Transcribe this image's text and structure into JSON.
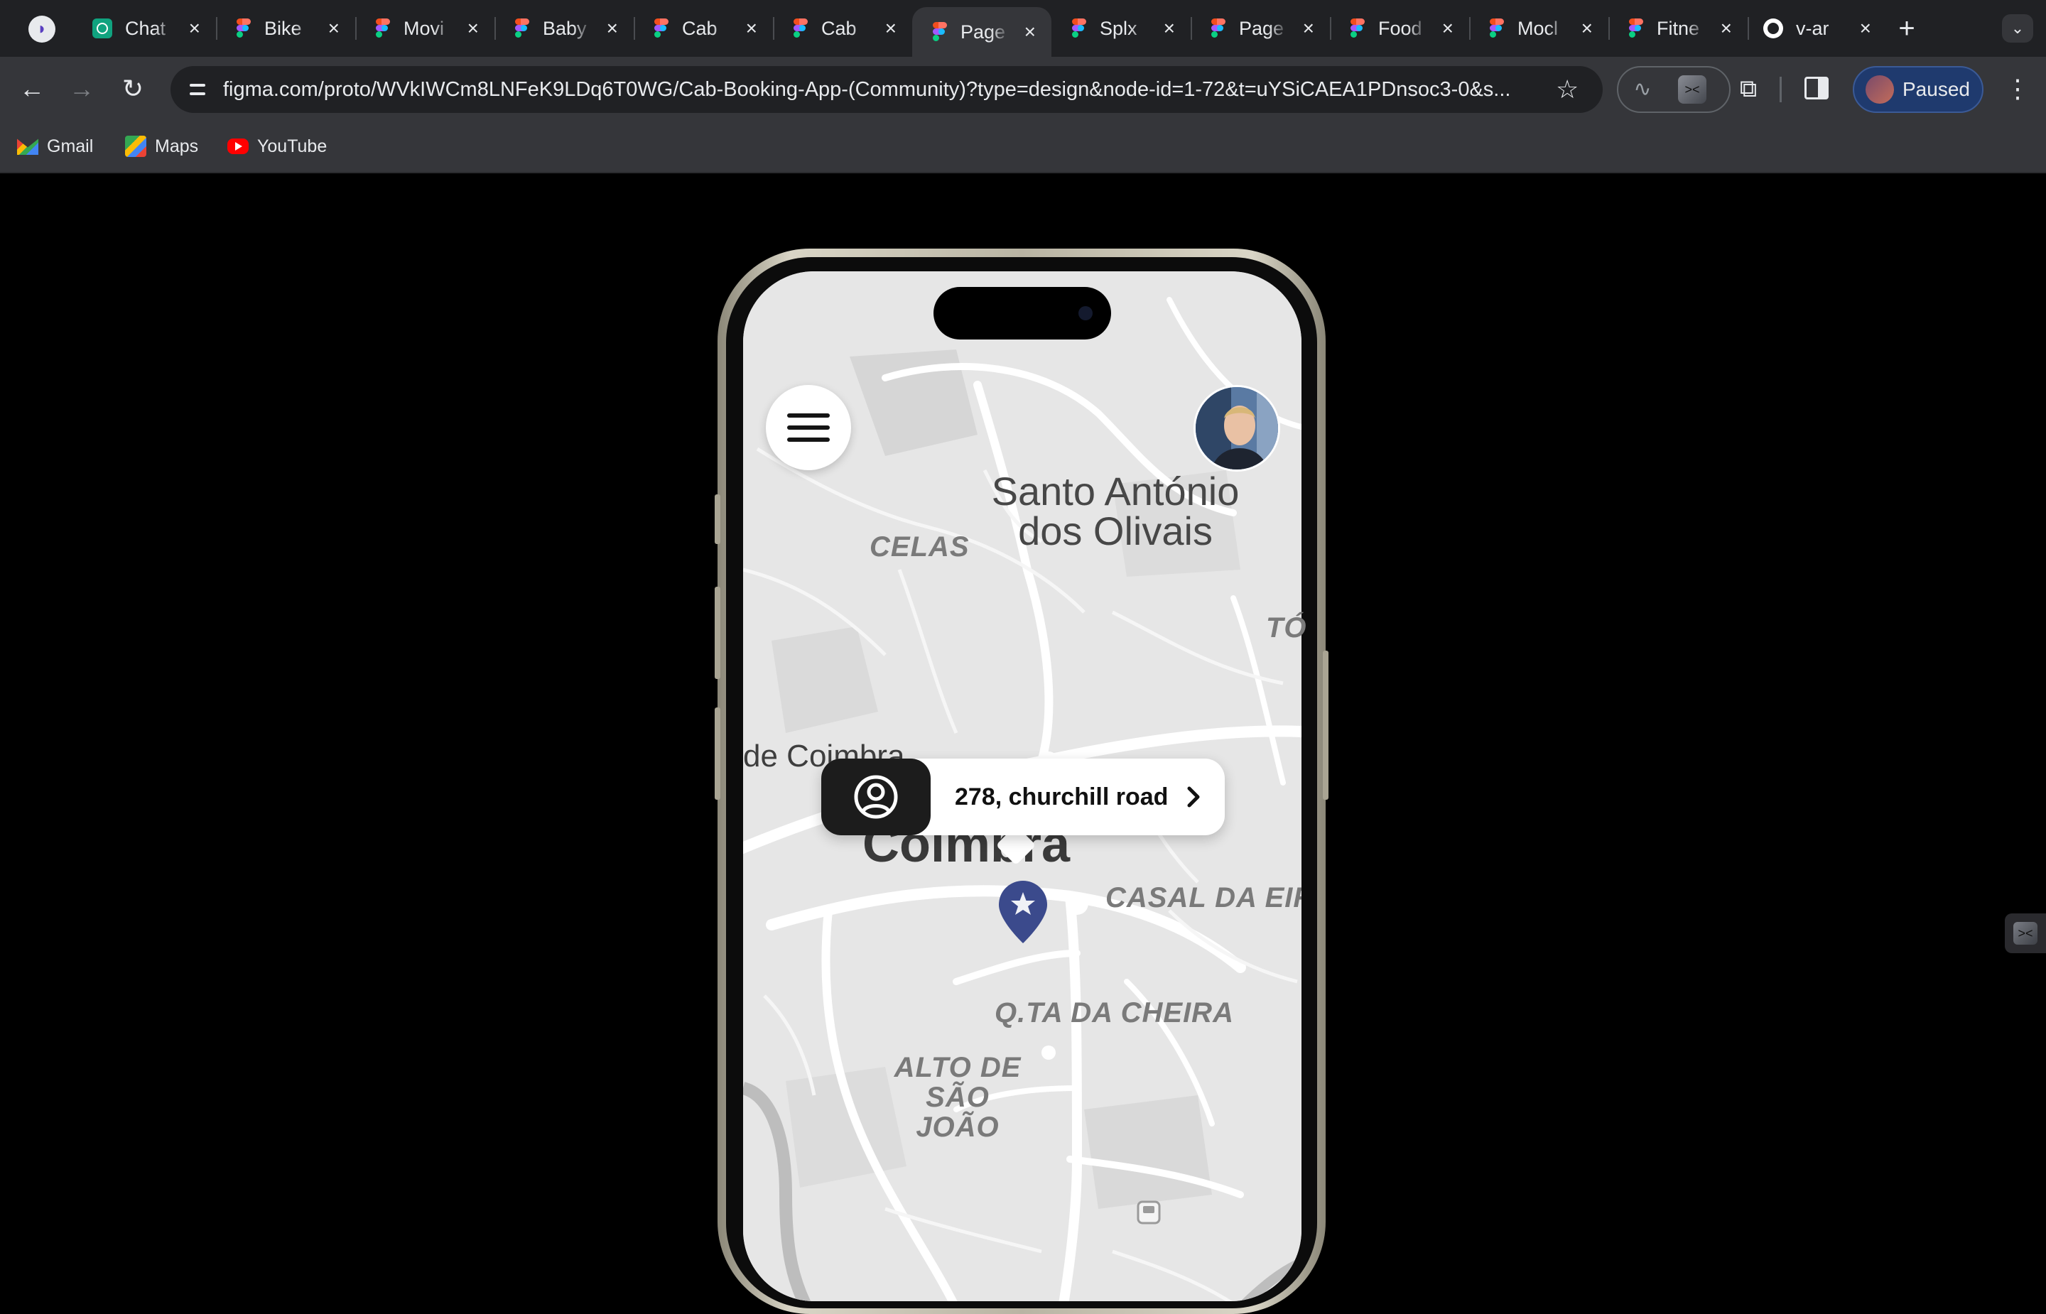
{
  "browser": {
    "tabs": [
      {
        "title": "Chat",
        "favicon": "chatgpt-icon"
      },
      {
        "title": "Bike",
        "favicon": "figma-icon"
      },
      {
        "title": "Movi",
        "favicon": "figma-icon"
      },
      {
        "title": "Baby",
        "favicon": "figma-icon"
      },
      {
        "title": "Cab",
        "favicon": "figma-icon"
      },
      {
        "title": "Cab",
        "favicon": "figma-icon"
      },
      {
        "title": "Page",
        "favicon": "figma-icon",
        "active": true
      },
      {
        "title": "Splx",
        "favicon": "figma-icon"
      },
      {
        "title": "Page",
        "favicon": "figma-icon"
      },
      {
        "title": "Food",
        "favicon": "figma-icon"
      },
      {
        "title": "Mocl",
        "favicon": "figma-icon"
      },
      {
        "title": "Fitne",
        "favicon": "figma-icon"
      },
      {
        "title": "v-ar",
        "favicon": "github-icon"
      }
    ],
    "url": "figma.com/proto/WVkIWCm8LNFeK9LDq6T0WG/Cab-Booking-App-(Community)?type=design&node-id=1-72&t=uYSiCAEA1PDnsoc3-0&s...",
    "profile": {
      "label": "Paused"
    },
    "bookmarks": [
      {
        "label": "Gmail",
        "icon": "gmail-icon"
      },
      {
        "label": "Maps",
        "icon": "maps-icon"
      },
      {
        "label": "YouTube",
        "icon": "youtube-icon"
      }
    ],
    "icons": {
      "back": "back-arrow-icon",
      "forward": "forward-arrow-icon",
      "reload": "reload-icon",
      "bookmark_star": "star-icon",
      "extensions": "puzzle-icon",
      "side_panel": "side-panel-icon",
      "menu": "kebab-menu-icon"
    }
  },
  "app": {
    "map_labels": {
      "santo_antonio": "Santo António\ndos Olivais",
      "celas": "CELAS",
      "to": "TÓ",
      "de_coimbra": "de Coimbra",
      "coimbra": "Coimbra",
      "casal": "CASAL DA EIR",
      "cheira": "Q.TA DA CHEIRA",
      "alto": "ALTO DE\nSÃO JOÃO"
    },
    "address_card": {
      "address": "278, churchill road",
      "icon": "user-circle-icon",
      "chevron": "chevron-right-icon"
    },
    "pin_icon": "star-pin-icon",
    "menu_icon": "hamburger-menu-icon",
    "avatar": "user-avatar"
  },
  "colors": {
    "pin": "#3b4a8c",
    "address_icon_bg": "#1c1c1c",
    "page_bg": "#000000",
    "map_bg": "#e8e8e8"
  }
}
